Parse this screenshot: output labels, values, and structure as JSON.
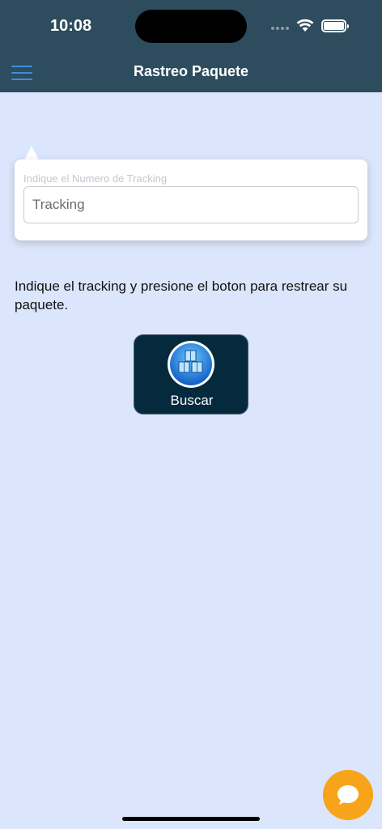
{
  "status_bar": {
    "time": "10:08"
  },
  "nav": {
    "title": "Rastreo Paquete",
    "menu_icon": "hamburger-menu-icon"
  },
  "tracking_card": {
    "label": "Indique el Numero de Tracking",
    "input_placeholder": "Tracking",
    "input_value": ""
  },
  "instructions": "Indique el tracking y presione el boton para restrear su paquete.",
  "search_button": {
    "label": "Buscar",
    "icon": "boxes-icon"
  },
  "chat": {
    "icon": "chat-bubble-icon"
  },
  "colors": {
    "header": "#2d4c5e",
    "background": "#dbe5fb",
    "menu_accent": "#3d8fe0",
    "button_bg": "#052a3d",
    "chat_button": "#f8a41a"
  }
}
